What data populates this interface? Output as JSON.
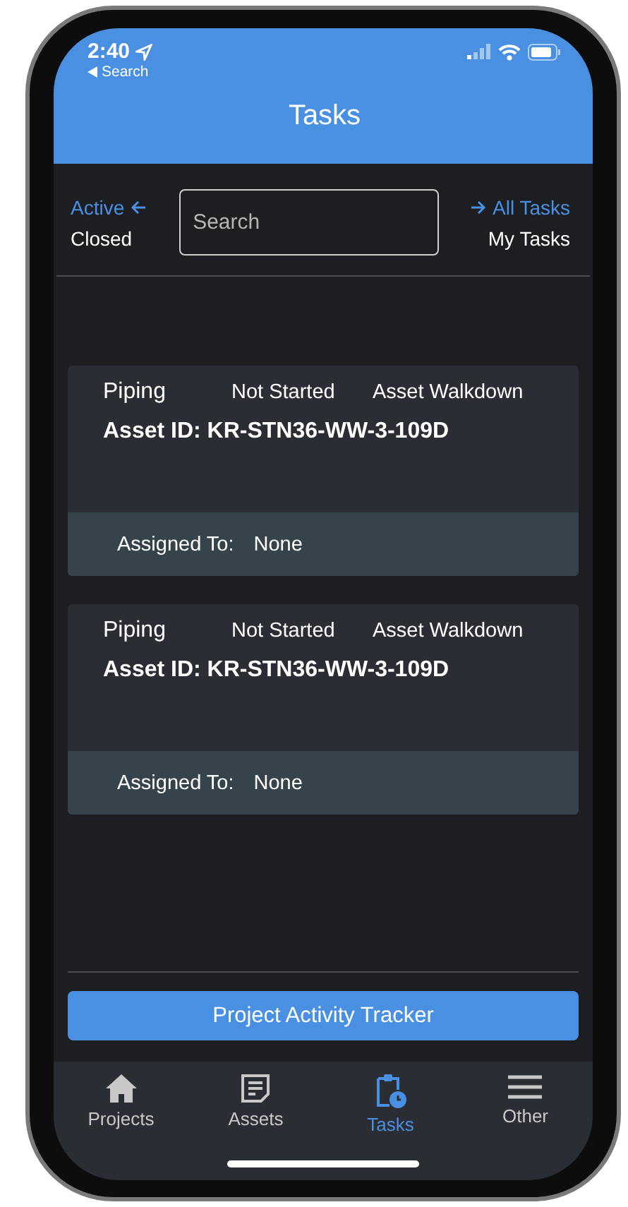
{
  "status_bar": {
    "time": "2:40",
    "back_label": "Search"
  },
  "header": {
    "title": "Tasks"
  },
  "filters": {
    "status_options": [
      {
        "label": "Active",
        "selected": true
      },
      {
        "label": "Closed",
        "selected": false
      }
    ],
    "search": {
      "placeholder": "Search"
    },
    "scope_options": [
      {
        "label": "All Tasks",
        "selected": true
      },
      {
        "label": "My Tasks",
        "selected": false
      }
    ]
  },
  "tasks": [
    {
      "category": "Piping",
      "status": "Not Started",
      "type": "Asset Walkdown",
      "asset_id": "Asset ID: KR-STN36-WW-3-109D",
      "assigned_label": "Assigned To:",
      "assigned_value": "None"
    },
    {
      "category": "Piping",
      "status": "Not Started",
      "type": "Asset Walkdown",
      "asset_id": "Asset ID: KR-STN36-WW-3-109D",
      "assigned_label": "Assigned To:",
      "assigned_value": "None"
    }
  ],
  "action_button": "Project Activity Tracker",
  "tab_bar": [
    {
      "label": "Projects",
      "selected": false
    },
    {
      "label": "Assets",
      "selected": false
    },
    {
      "label": "Tasks",
      "selected": true
    },
    {
      "label": "Other",
      "selected": false
    }
  ]
}
